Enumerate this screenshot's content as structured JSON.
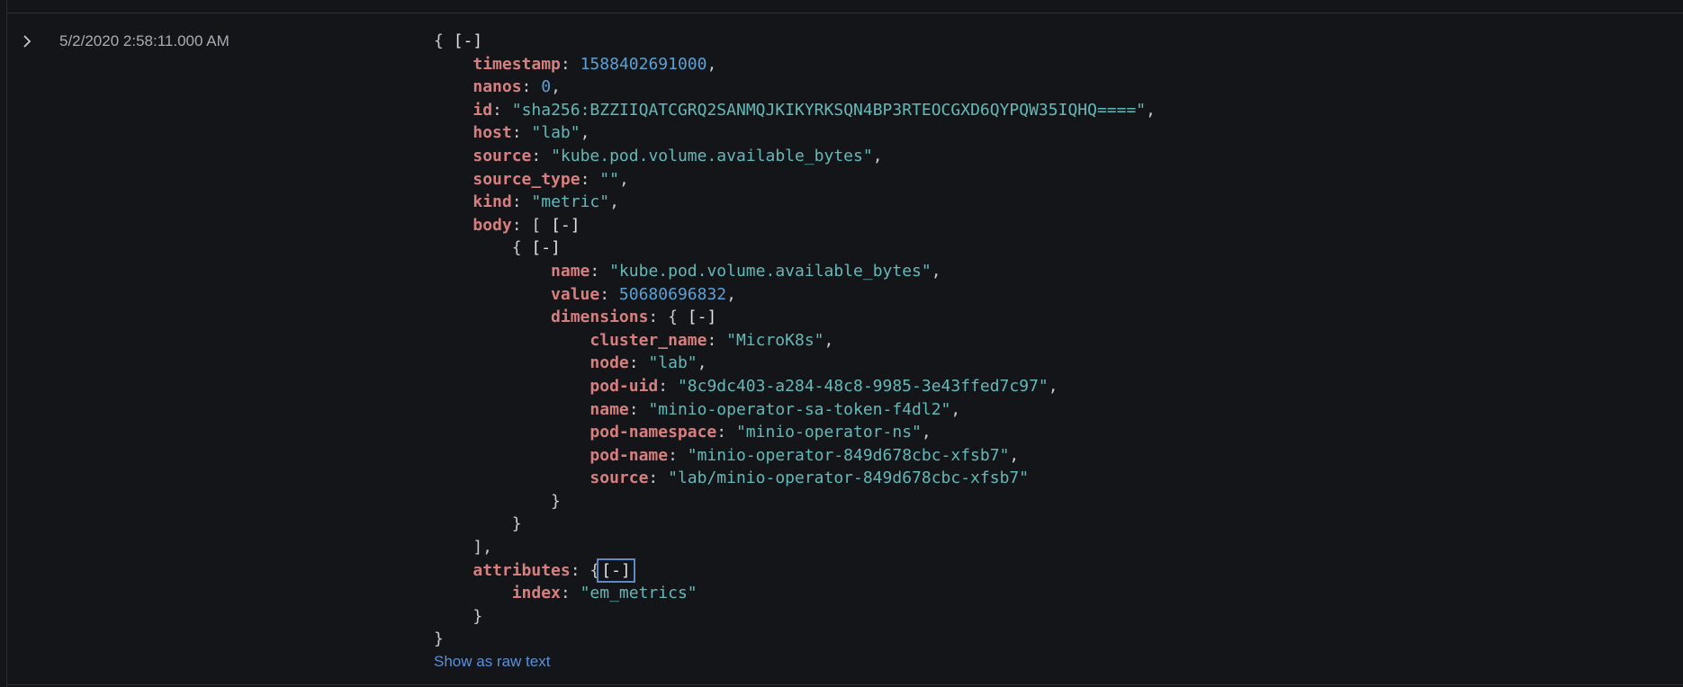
{
  "event": {
    "expand_icon": "chevron-right-icon",
    "timestamp_display": "5/2/2020 2:58:11.000 AM",
    "collapse_label": "[-]",
    "show_raw_label": "Show as raw text"
  },
  "doc": {
    "k": {
      "timestamp": "timestamp",
      "nanos": "nanos",
      "id": "id",
      "host": "host",
      "source": "source",
      "source_type": "source_type",
      "kind": "kind",
      "body": "body",
      "name": "name",
      "value": "value",
      "dimensions": "dimensions",
      "cluster_name": "cluster_name",
      "node": "node",
      "pod_uid": "pod-uid",
      "dim_name": "name",
      "pod_namespace": "pod-namespace",
      "pod_name": "pod-name",
      "dim_source": "source",
      "attributes": "attributes",
      "index": "index"
    },
    "v": {
      "timestamp": "1588402691000",
      "nanos": "0",
      "id": "\"sha256:BZZIIQATCGRQ2SANMQJKIKYRKSQN4BP3RTEOCGXD6QYPQW35IQHQ====\"",
      "host": "\"lab\"",
      "source": "\"kube.pod.volume.available_bytes\"",
      "source_type": "\"\"",
      "kind": "\"metric\"",
      "name": "\"kube.pod.volume.available_bytes\"",
      "value": "50680696832",
      "cluster_name": "\"MicroK8s\"",
      "node": "\"lab\"",
      "pod_uid": "\"8c9dc403-a284-48c8-9985-3e43ffed7c97\"",
      "dim_name": "\"minio-operator-sa-token-f4dl2\"",
      "pod_namespace": "\"minio-operator-ns\"",
      "pod_name": "\"minio-operator-849d678cbc-xfsb7\"",
      "dim_source": "\"lab/minio-operator-849d678cbc-xfsb7\"",
      "index": "\"em_metrics\""
    }
  }
}
